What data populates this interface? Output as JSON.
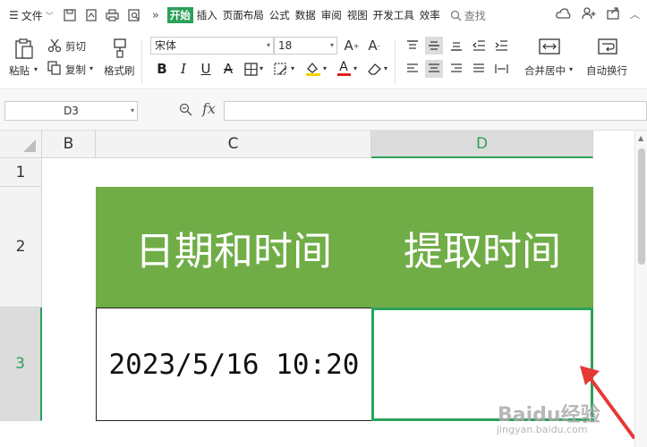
{
  "menubar": {
    "file_label": "文件",
    "tabs": [
      "开始",
      "插入",
      "页面布局",
      "公式",
      "数据",
      "审阅",
      "视图",
      "开发工具",
      "效率"
    ],
    "active_tab": "开始",
    "search_label": "查找"
  },
  "ribbon": {
    "paste_label": "粘贴",
    "cut_label": "剪切",
    "copy_label": "复制",
    "format_painter_label": "格式刷",
    "font_name": "宋体",
    "font_size": "18",
    "bold": "B",
    "italic": "I",
    "underline": "U",
    "strike": "A",
    "font_color_glyph": "A",
    "merge_center_label": "合并居中",
    "wrap_text_label": "自动换行"
  },
  "formula_bar": {
    "cell_ref": "D3",
    "fx_label": "fx",
    "content": ""
  },
  "sheet": {
    "columns": [
      "B",
      "C",
      "D"
    ],
    "rows": [
      "1",
      "2",
      "3"
    ],
    "selected_cell": "D3",
    "header_c2": "日期和时间",
    "header_d2": "提取时间",
    "value_c3": "2023/5/16  10:20",
    "value_d3": ""
  },
  "colors": {
    "accent": "#2ca15a",
    "header_fill": "#70ad47",
    "annotation_arrow": "#e53935"
  },
  "watermark": {
    "main": "Baidu经验",
    "sub": "jingyan.baidu.com"
  }
}
